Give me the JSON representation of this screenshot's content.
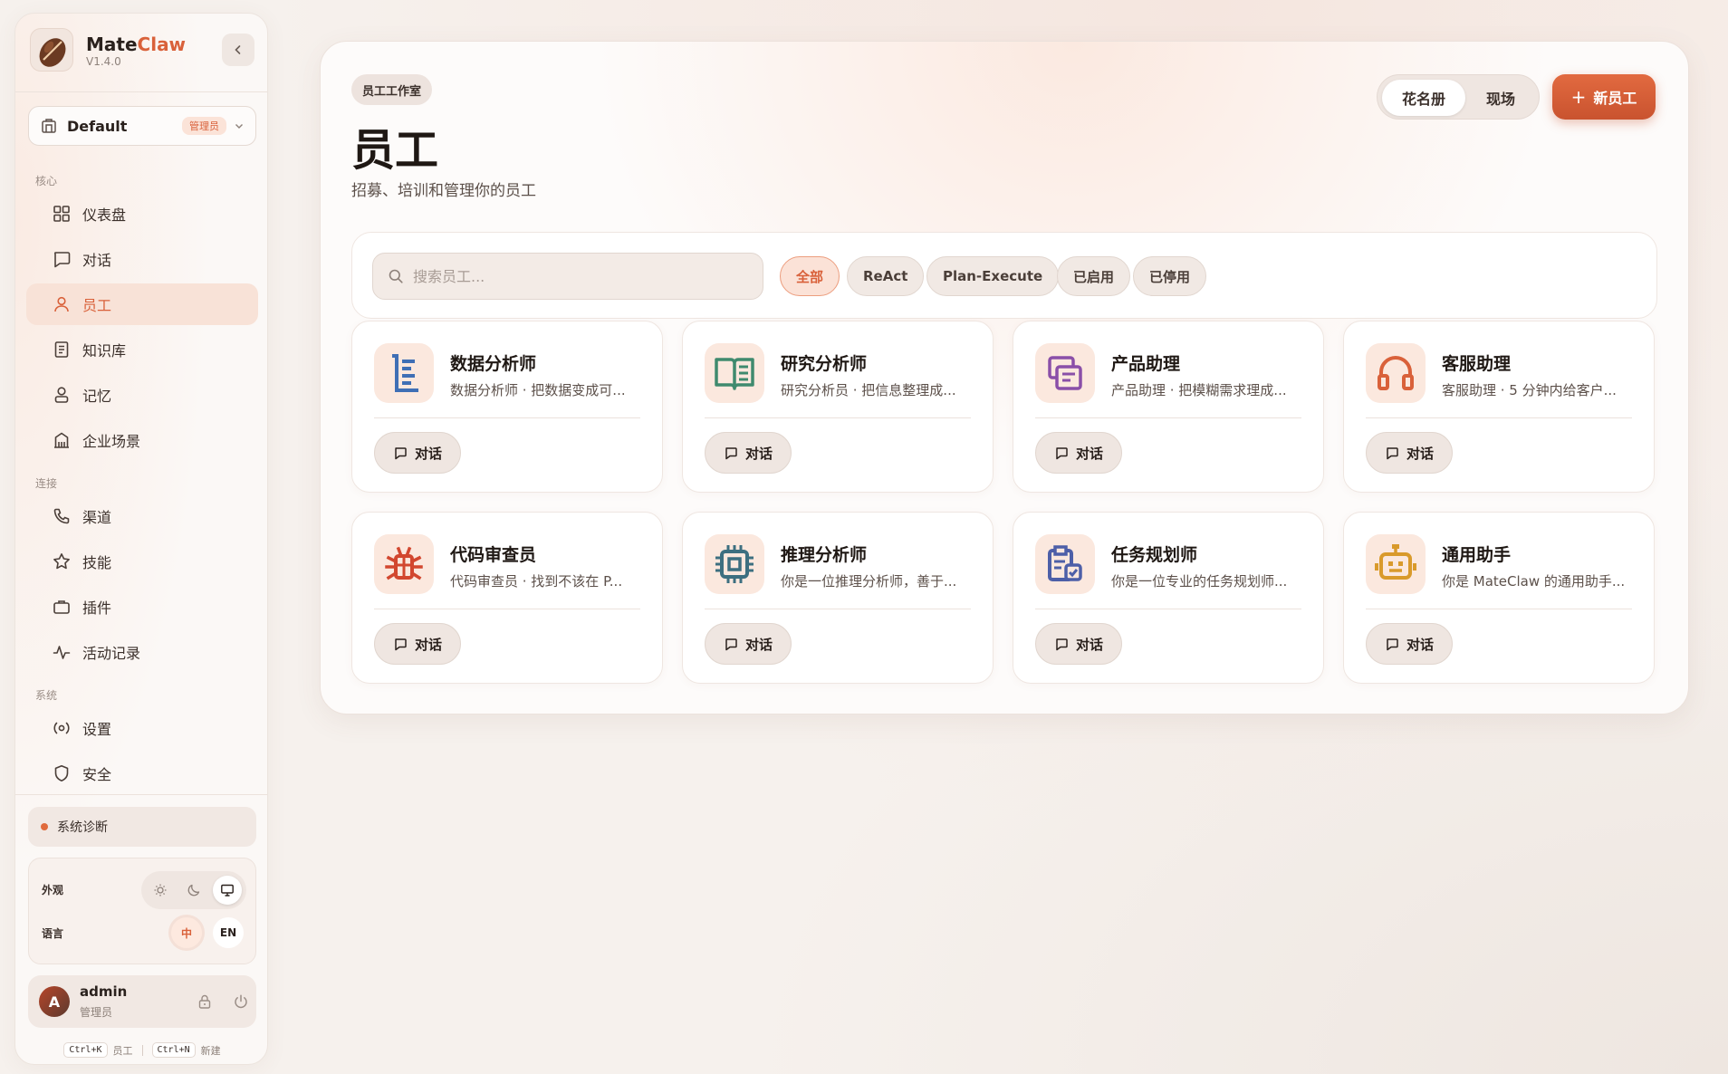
{
  "brand": {
    "name_main": "Mate",
    "name_accent": "Claw",
    "version": "V1.4.0"
  },
  "workspace": {
    "name": "Default",
    "role_badge": "管理员"
  },
  "sections": {
    "core": "核心",
    "connect": "连接",
    "system": "系统"
  },
  "nav": [
    {
      "label": "仪表盘",
      "icon": "dashboard-icon"
    },
    {
      "label": "对话",
      "icon": "chat-icon"
    },
    {
      "label": "员工",
      "icon": "user-icon",
      "active": true
    },
    {
      "label": "知识库",
      "icon": "book-icon"
    },
    {
      "label": "记忆",
      "icon": "memory-icon"
    },
    {
      "label": "企业场景",
      "icon": "building-icon"
    },
    {
      "label": "渠道",
      "icon": "phone-icon"
    },
    {
      "label": "技能",
      "icon": "star-icon"
    },
    {
      "label": "插件",
      "icon": "briefcase-icon"
    },
    {
      "label": "活动记录",
      "icon": "activity-icon"
    },
    {
      "label": "设置",
      "icon": "settings-icon"
    },
    {
      "label": "安全",
      "icon": "shield-icon"
    }
  ],
  "diagnostics": {
    "label": "系统诊断",
    "status_color": "#e06a3c"
  },
  "prefs": {
    "appearance_label": "外观",
    "language_label": "语言",
    "lang_zh": "中",
    "lang_en": "EN",
    "theme_active": "system"
  },
  "user": {
    "initial": "A",
    "name": "admin",
    "role": "管理员"
  },
  "shortcuts": [
    {
      "key": "Ctrl+K",
      "label": "员工"
    },
    {
      "key": "Ctrl+N",
      "label": "新建"
    }
  ],
  "header": {
    "tag": "员工工作室",
    "title": "员工",
    "subtitle": "招募、培训和管理你的员工",
    "view_roster": "花名册",
    "view_live": "现场",
    "new_button": "新员工"
  },
  "search": {
    "placeholder": "搜索员工..."
  },
  "filters": [
    "全部",
    "ReAct",
    "Plan-Execute",
    "已启用",
    "已停用"
  ],
  "chat_label": "对话",
  "agents": [
    {
      "name": "数据分析师",
      "desc": "数据分析师 · 把数据变成可...",
      "icon": "list-doc-icon",
      "color": "#3f6fb5"
    },
    {
      "name": "研究分析师",
      "desc": "研究分析员 · 把信息整理成...",
      "icon": "open-book-icon",
      "color": "#3f8a6e"
    },
    {
      "name": "产品助理",
      "desc": "产品助理 · 把模糊需求理成...",
      "icon": "layers-icon",
      "color": "#8a4fa8"
    },
    {
      "name": "客服助理",
      "desc": "客服助理 · 5 分钟内给客户...",
      "icon": "headphones-icon",
      "color": "#d9613a"
    },
    {
      "name": "代码审查员",
      "desc": "代码审查员 · 找到不该在 P...",
      "icon": "bug-icon",
      "color": "#d2472f"
    },
    {
      "name": "推理分析师",
      "desc": "你是一位推理分析师，善于...",
      "icon": "cpu-icon",
      "color": "#3d6f80"
    },
    {
      "name": "任务规划师",
      "desc": "你是一位专业的任务规划师...",
      "icon": "task-board-icon",
      "color": "#4d5fa8"
    },
    {
      "name": "通用助手",
      "desc": "你是 MateClaw 的通用助手...",
      "icon": "robot-icon",
      "color": "#d99a2b"
    }
  ],
  "accent_color": "#d9613a"
}
